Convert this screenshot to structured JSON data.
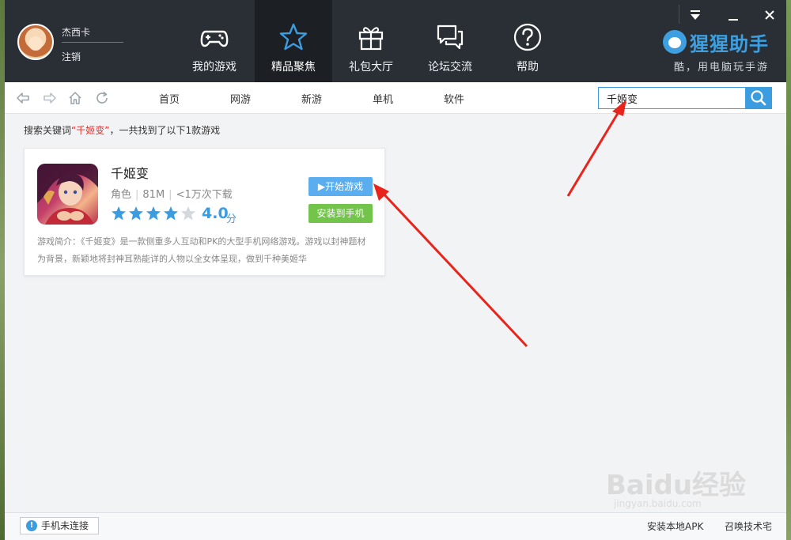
{
  "user": {
    "name": "杰西卡",
    "logout_label": "注销"
  },
  "nav": {
    "tabs": [
      {
        "label": "我的游戏",
        "icon": "gamepad-icon",
        "active": false
      },
      {
        "label": "精品聚焦",
        "icon": "star-icon",
        "active": true
      },
      {
        "label": "礼包大厅",
        "icon": "gift-icon",
        "active": false
      },
      {
        "label": "论坛交流",
        "icon": "chat-icon",
        "active": false
      },
      {
        "label": "帮助",
        "icon": "help-icon",
        "active": false
      }
    ]
  },
  "brand": {
    "name": "猩猩助手",
    "tagline": "酷，用电脑玩手游"
  },
  "categories": [
    "首页",
    "网游",
    "新游",
    "单机",
    "软件"
  ],
  "search": {
    "value": "千姬变"
  },
  "results": {
    "prefix": "搜索关键词",
    "keyword": "“千姬变”",
    "suffix": "，一共找到了以下1款游戏"
  },
  "game": {
    "title": "千姬变",
    "genre": "角色",
    "size": "81M",
    "downloads": "<1万次下载",
    "rating": "4.0",
    "rating_unit": "分",
    "rating_stars": 4,
    "play_label": "开始游戏",
    "install_label": "安装到手机",
    "description": "游戏简介：《千姬变》是一款侧重多人互动和PK的大型手机网络游戏。游戏以封神题材为背景，新颖地将封神耳熟能详的人物以全女体呈现，做到千种美姬华"
  },
  "statusbar": {
    "phone_status": "手机未连接",
    "install_apk": "安装本地APK",
    "summon_label": "召唤技术宅"
  },
  "watermark": {
    "main": "Baidu经验",
    "sub": "jingyan.baidu.com"
  },
  "colors": {
    "accent": "#3b9de0",
    "install_green": "#72c44a",
    "header_bg": "#2a2f36",
    "annotation_red": "#e8241c"
  }
}
